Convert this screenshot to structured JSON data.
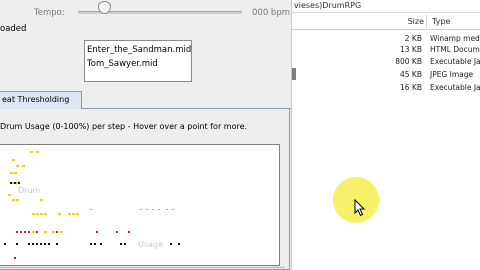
{
  "tempo": {
    "label": "Tempo:",
    "value_label": "000 bpm",
    "slider_fraction": 0.16
  },
  "loaded": {
    "label": "oaded",
    "files": [
      "Enter_the_Sandman.mid",
      "Tom_Sawyer.mid"
    ]
  },
  "tabs": [
    {
      "label": "eat Thresholding",
      "selected": true
    }
  ],
  "panel": {
    "title": "Drum Usage (0-100%) per step - Hover over a point for more."
  },
  "chart_data": {
    "type": "scatter",
    "title": "Drum Usage (0-100%) per step - Hover over a point for more.",
    "faint_labels": [
      "Drum",
      "Usage"
    ],
    "colors": {
      "yellow": "#f0d020",
      "red": "#d02020",
      "black": "#111111",
      "grey": "#aaaaaa"
    }
  },
  "explorer": {
    "path": "vieses)DrumRPG",
    "columns": {
      "size": "Size",
      "type": "Type"
    },
    "rows": [
      {
        "size": "2 KB",
        "type": "Winamp medi"
      },
      {
        "size": "13 KB",
        "type": "HTML Docume"
      },
      {
        "size": "800 KB",
        "type": "Executable Ja"
      },
      {
        "size": "45 KB",
        "type": "JPEG Image"
      },
      {
        "size": "16 KB",
        "type": "Executable Ja"
      }
    ]
  },
  "cursor": {
    "highlight_color": "#f7f16a"
  }
}
